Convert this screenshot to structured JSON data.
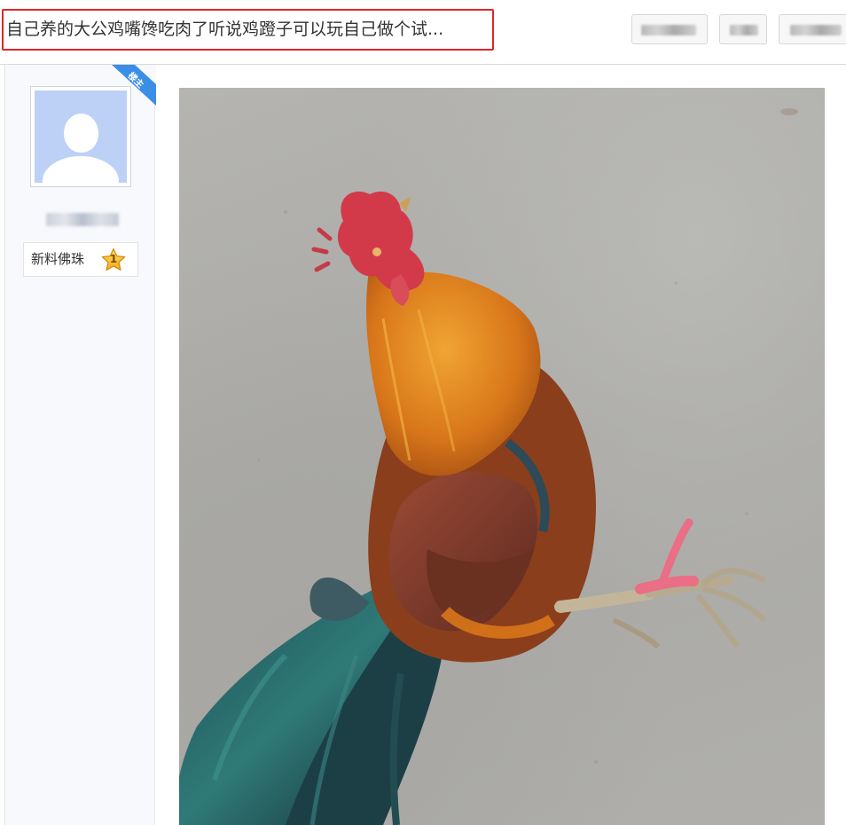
{
  "header": {
    "title": "自己养的大公鸡嘴馋吃肉了听说鸡蹬子可以玩自己做个试...",
    "buttons": [
      {
        "label": "",
        "blurred": true
      },
      {
        "label": "",
        "blurred": true
      },
      {
        "label": "",
        "blurred": true
      }
    ],
    "highlight_color": "#e0262a"
  },
  "post": {
    "author": {
      "badge": "楼主",
      "badge_color": "#3b8ee5",
      "avatar": "default-avatar",
      "username_blurred": true,
      "level_name": "新料佛珠",
      "level_number": "1",
      "level_icon": "star-icon"
    },
    "image": {
      "subject": "rooster-photo"
    }
  }
}
